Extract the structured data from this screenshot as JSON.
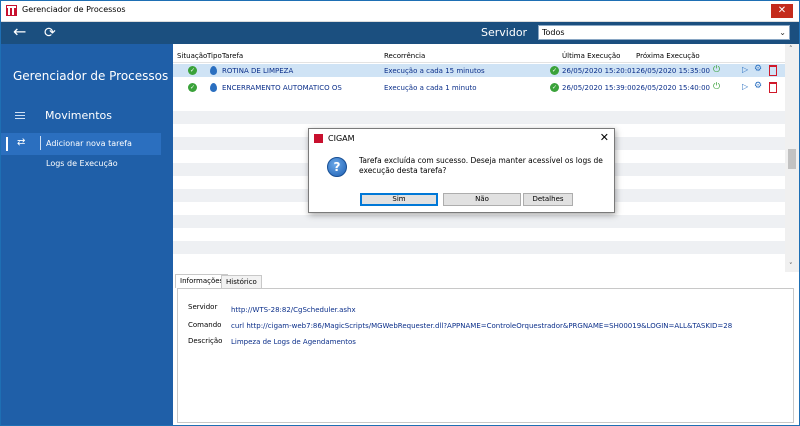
{
  "window": {
    "title": "Gerenciador de Processos",
    "close_glyph": "✕"
  },
  "topbar": {
    "back_icon": "←",
    "refresh_icon": "⟳",
    "server_label": "Servidor",
    "server_value": "Todos",
    "server_chevron": "⌄"
  },
  "sidebar": {
    "app_title": "Gerenciador de Processos",
    "section_label": "Movimentos",
    "items": [
      {
        "label": "Adicionar nova tarefa",
        "active": true
      },
      {
        "label": "Logs de Execução",
        "active": false
      }
    ]
  },
  "table": {
    "columns": [
      "Situação",
      "Tipo",
      "Tarefa",
      "Recorrência",
      "Última Execução",
      "Próxima Execução"
    ],
    "rows": [
      {
        "tarefa": "ROTINA DE LIMPEZA",
        "recorrencia": "Execução a cada 15 minutos",
        "ultima": "26/05/2020 15:20:01",
        "proxima": "26/05/2020 15:35:00",
        "selected": true
      },
      {
        "tarefa": "ENCERRAMENTO AUTOMATICO OS",
        "recorrencia": "Execução a cada 1 minuto",
        "ultima": "26/05/2020 15:39:00",
        "proxima": "26/05/2020 15:40:00",
        "selected": false
      }
    ]
  },
  "tabs": [
    {
      "label": "Informações",
      "active": true
    },
    {
      "label": "Histórico",
      "active": false
    }
  ],
  "info": {
    "servidor_label": "Servidor",
    "servidor_value": "http://WTS-28:82/CgScheduler.ashx",
    "comando_label": "Comando",
    "comando_value": "curl http://cigam-web7:86/MagicScripts/MGWebRequester.dll?APPNAME=ControleOrquestrador&PRGNAME=SH00019&LOGIN=ALL&TASKID=28",
    "descricao_label": "Descrição",
    "descricao_value": "Limpeza de Logs de Agendamentos"
  },
  "dialog": {
    "title": "CIGAM",
    "close_glyph": "✕",
    "icon_glyph": "?",
    "message": "Tarefa excluída com sucesso. Deseja manter acessível os logs de execução desta tarefa?",
    "buttons": [
      "Sim",
      "Não",
      "Detalhes"
    ]
  },
  "colors": {
    "sidebar": "#1f5fa8",
    "topbar": "#1b4f7f",
    "selected_row": "#cfe3f5",
    "link_blue": "#0b2f8a",
    "ok_green": "#3aa23a",
    "delete_red": "#d0192a"
  }
}
